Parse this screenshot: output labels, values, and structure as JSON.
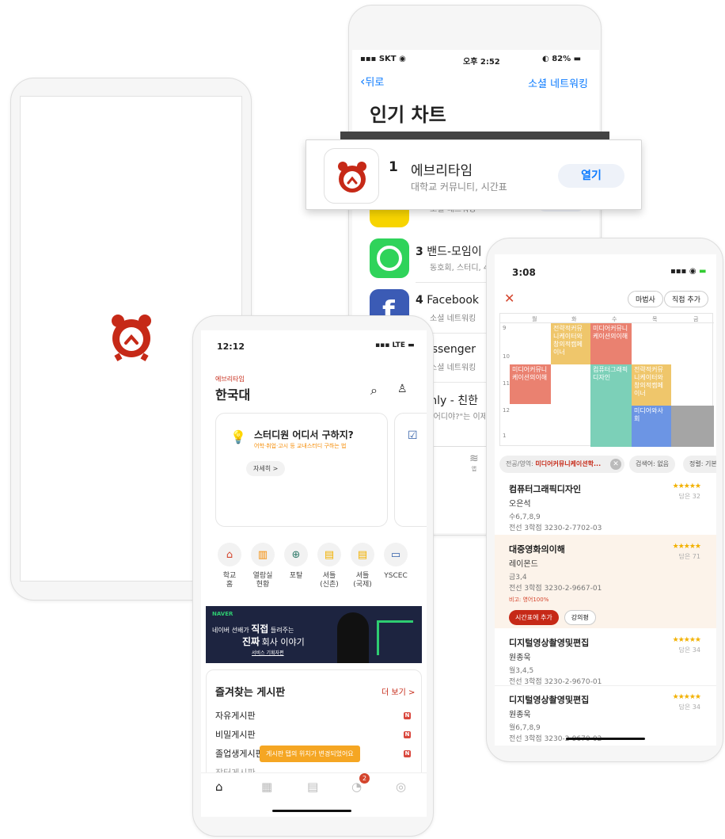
{
  "colors": {
    "brand": "#c62917",
    "ios_blue": "#0a7aff",
    "orange": "#f58a00"
  },
  "app_store": {
    "status": {
      "carrier": "SKT",
      "time": "오후 2:52",
      "battery": "82%"
    },
    "back_label": "뒤로",
    "category": "소셜 네트워킹",
    "title": "인기 차트",
    "popup": {
      "rank": "1",
      "name": "에브리타임",
      "subtitle": "대학교 커뮤니티, 시간표",
      "button": "열기"
    },
    "rows": [
      {
        "rank": "",
        "name": "",
        "subtitle": "소셜 네트워킹",
        "button": "열기",
        "icon": "kakaotalk-icon"
      },
      {
        "rank": "3",
        "name": "밴드-모임이",
        "subtitle": "동호회, 스터디, 4",
        "icon": "band-icon"
      },
      {
        "rank": "4",
        "name": "Facebook",
        "subtitle": "소셜 네트워킹",
        "icon": "facebook-icon"
      },
      {
        "rank": "",
        "name": "Messenger",
        "subtitle": "소셜 네트워킹",
        "icon": "messenger-icon"
      },
      {
        "rank": "",
        "name": "Zenly - 친한",
        "subtitle": "\"어디야?\"는 이제",
        "icon": "zenly-icon"
      }
    ],
    "tab_label": "앱"
  },
  "timetable": {
    "time": "3:08",
    "btn_wizard": "마법사",
    "btn_direct": "직접 추가",
    "days": [
      "월",
      "화",
      "수",
      "목",
      "금"
    ],
    "hours": [
      "9",
      "10",
      "11",
      "12",
      "1"
    ],
    "blocks": [
      {
        "label": "전략적커뮤니케이터와창의적캠페이너"
      },
      {
        "label": "미디어커뮤니케이션의이해"
      },
      {
        "label": "미디어커뮤니케이션의이해"
      },
      {
        "label": "컴퓨터그래픽디자인"
      },
      {
        "label": "전략적커뮤니케이터와창의적캠페이너"
      },
      {
        "label": "미디어와사회"
      }
    ],
    "filters": {
      "major_label": "전공/영역:",
      "major_value": "미디어커뮤니케이션학...",
      "search_label": "검색어: 없음",
      "sort_label": "정렬: 기본"
    },
    "lectures": [
      {
        "title": "컴퓨터그래픽디자인",
        "prof": "오은석",
        "stars": "★★★★★",
        "reviews": "담은 32",
        "time": "수6,7,8,9",
        "meta": "전선  3학점  3230-2-7702-03"
      },
      {
        "title": "대중영화의이해",
        "prof": "레이몬드",
        "stars": "★★★★★",
        "reviews": "담은 71",
        "time": "금3,4",
        "meta": "전선  3학점  3230-2-9667-01",
        "note": "비고: 영어100%",
        "btn_add": "시간표에 추가",
        "btn_info": "강의평"
      },
      {
        "title": "디지털영상촬영및편집",
        "prof": "원종욱",
        "stars": "★★★★★",
        "reviews": "담은 34",
        "time": "월3,4,5",
        "meta": "전선  3학점  3230-2-9670-01"
      },
      {
        "title": "디지털영상촬영및편집",
        "prof": "원종욱",
        "stars": "★★★★★",
        "reviews": "담은 34",
        "time": "월6,7,8,9",
        "meta": "전선  3학점  3230-2-9670-02"
      }
    ]
  },
  "main_app": {
    "status": {
      "time": "12:12",
      "network": "LTE"
    },
    "brand_small": "에브리타임",
    "school": "한국대",
    "card": {
      "title": "스터디원 어디서 구하지?",
      "subtitle": "어학·취업·고시 등 교내스터디 구하는 법",
      "button": "자세히 >"
    },
    "quick": [
      {
        "label": "학교\n홈",
        "icon": "home-icon"
      },
      {
        "label": "열람실\n현황",
        "icon": "book-icon"
      },
      {
        "label": "포탈",
        "icon": "globe-icon"
      },
      {
        "label": "셔틀\n(신촌)",
        "icon": "bus-icon"
      },
      {
        "label": "셔틀\n(국제)",
        "icon": "bus-icon"
      },
      {
        "label": "YSCEC",
        "icon": "monitor-icon"
      }
    ],
    "banner": {
      "brand": "NAVER",
      "line1": "네이버 선배가",
      "bold1": "직접",
      "line1b": "들려주는",
      "bold2": "진짜",
      "line2": "회사 이야기",
      "sub": "서비스 기획자편"
    },
    "favorites": {
      "title": "즐겨찾는 게시판",
      "more": "더 보기 >",
      "items": [
        "자유게시판",
        "비밀게시판",
        "졸업생게시판",
        "장터게시판"
      ],
      "badge": "N"
    },
    "toast": "게시판 탭의 위치가 변경되었어요",
    "notification_count": "2"
  }
}
